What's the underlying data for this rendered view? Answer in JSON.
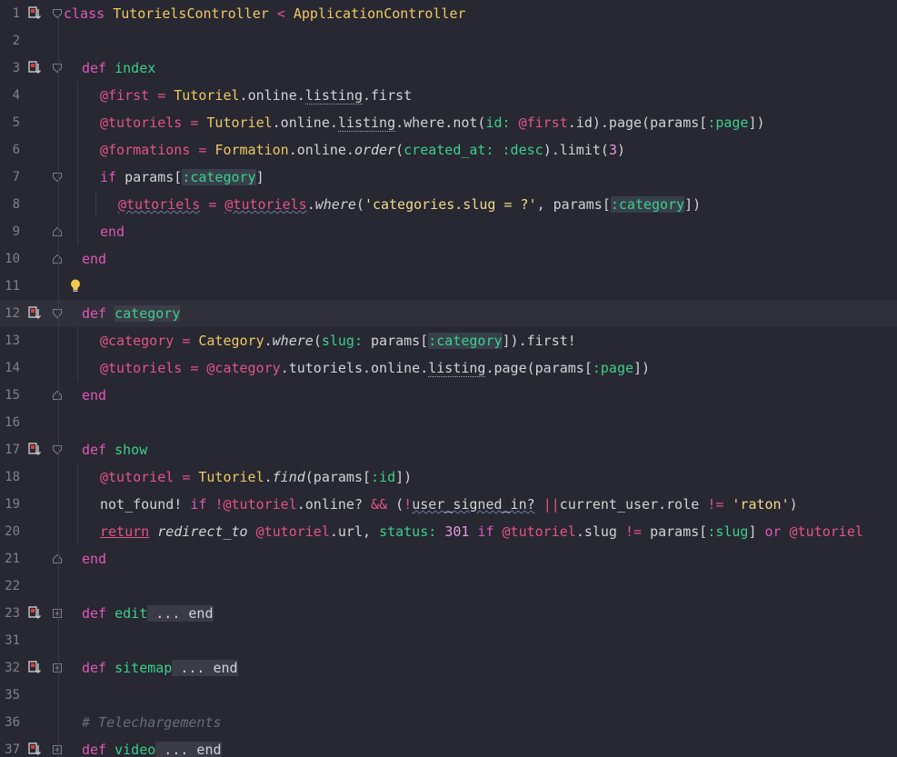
{
  "editor": {
    "lines": [
      {
        "n": "1",
        "tokens": [
          [
            "k",
            "class"
          ],
          [
            "",
            "&#32;"
          ],
          [
            "c",
            "TutorielsController"
          ],
          [
            "",
            "&#32;"
          ],
          [
            "i",
            "<"
          ],
          [
            "",
            "&#32;"
          ],
          [
            "c",
            "ApplicationController"
          ]
        ]
      }
    ]
  },
  "lines": [
    {
      "n": "1",
      "marker": true,
      "fold": "open",
      "indent": 0,
      "tokens": [
        [
          "k",
          "class"
        ],
        [
          "",
          " "
        ],
        [
          "c",
          "TutorielsController"
        ],
        [
          "",
          " "
        ],
        [
          "i",
          "<"
        ],
        [
          "",
          " "
        ],
        [
          "c",
          "ApplicationController"
        ]
      ]
    },
    {
      "n": "2",
      "tokens": []
    },
    {
      "n": "3",
      "marker": true,
      "fold": "open",
      "indent": 1,
      "tokens": [
        [
          "k",
          "def"
        ],
        [
          "",
          " "
        ],
        [
          "m",
          "index"
        ]
      ]
    },
    {
      "n": "4",
      "indent": 2,
      "tokens": [
        [
          "i",
          "@first"
        ],
        [
          "",
          " "
        ],
        [
          "i",
          "="
        ],
        [
          "",
          " "
        ],
        [
          "c",
          "Tutoriel"
        ],
        [
          "",
          "."
        ],
        [
          "",
          "online"
        ],
        [
          "",
          "."
        ],
        [
          "u",
          "listing"
        ],
        [
          "",
          "."
        ],
        [
          "",
          "first"
        ]
      ]
    },
    {
      "n": "5",
      "indent": 2,
      "tokens": [
        [
          "i",
          "@tutoriels"
        ],
        [
          "",
          " "
        ],
        [
          "i",
          "="
        ],
        [
          "",
          " "
        ],
        [
          "c",
          "Tutoriel"
        ],
        [
          "",
          ".online."
        ],
        [
          "u",
          "listing"
        ],
        [
          "",
          ".where.not("
        ],
        [
          "m",
          "id:"
        ],
        [
          "",
          " "
        ],
        [
          "i",
          "@first"
        ],
        [
          "",
          ".id).page(params["
        ],
        [
          "m",
          ":page"
        ],
        [
          "",
          "])"
        ]
      ]
    },
    {
      "n": "6",
      "indent": 2,
      "tokens": [
        [
          "i",
          "@formations"
        ],
        [
          "",
          " "
        ],
        [
          "i",
          "="
        ],
        [
          "",
          " "
        ],
        [
          "c",
          "Formation"
        ],
        [
          "",
          ".online."
        ],
        [
          "it",
          "order"
        ],
        [
          "",
          "("
        ],
        [
          "m",
          "created_at:"
        ],
        [
          "",
          " "
        ],
        [
          "m",
          ":desc"
        ],
        [
          "",
          ").limit("
        ],
        [
          "n",
          "3"
        ],
        [
          "",
          ")"
        ]
      ]
    },
    {
      "n": "7",
      "fold": "open",
      "indent": 2,
      "tokens": [
        [
          "k",
          "if"
        ],
        [
          "",
          " params["
        ],
        [
          "mhl",
          ":category"
        ],
        [
          "",
          "]"
        ]
      ]
    },
    {
      "n": "8",
      "indent": 3,
      "tokens": [
        [
          "iuw",
          "@tutoriels"
        ],
        [
          "",
          " "
        ],
        [
          "i",
          "="
        ],
        [
          "",
          " "
        ],
        [
          "iuw",
          "@tutoriels"
        ],
        [
          "",
          "."
        ],
        [
          "it",
          "where"
        ],
        [
          "",
          "("
        ],
        [
          "s",
          "'categories.slug = ?'"
        ],
        [
          "",
          ", params["
        ],
        [
          "mhl",
          ":category"
        ],
        [
          "",
          "])"
        ]
      ]
    },
    {
      "n": "9",
      "fold": "close",
      "indent": 2,
      "tokens": [
        [
          "k",
          "end"
        ]
      ]
    },
    {
      "n": "10",
      "fold": "close",
      "indent": 1,
      "tokens": [
        [
          "k",
          "end"
        ]
      ]
    },
    {
      "n": "11",
      "bulb": true,
      "tokens": []
    },
    {
      "n": "12",
      "marker": true,
      "fold": "open",
      "current": true,
      "indent": 1,
      "tokens": [
        [
          "k",
          "def"
        ],
        [
          "",
          " "
        ],
        [
          "msel",
          "category"
        ]
      ]
    },
    {
      "n": "13",
      "indent": 2,
      "tokens": [
        [
          "i",
          "@category"
        ],
        [
          "",
          " "
        ],
        [
          "i",
          "="
        ],
        [
          "",
          " "
        ],
        [
          "c",
          "Category"
        ],
        [
          "",
          "."
        ],
        [
          "it",
          "where"
        ],
        [
          "",
          "("
        ],
        [
          "m",
          "slug:"
        ],
        [
          "",
          " params["
        ],
        [
          "mhl",
          ":category"
        ],
        [
          "",
          "]).first!"
        ]
      ]
    },
    {
      "n": "14",
      "indent": 2,
      "tokens": [
        [
          "i",
          "@tutoriels"
        ],
        [
          "",
          " "
        ],
        [
          "i",
          "="
        ],
        [
          "",
          " "
        ],
        [
          "i",
          "@category"
        ],
        [
          "",
          ".tutoriels.online."
        ],
        [
          "u",
          "listing"
        ],
        [
          "",
          ".page(params["
        ],
        [
          "m",
          ":page"
        ],
        [
          "",
          "])"
        ]
      ]
    },
    {
      "n": "15",
      "fold": "close",
      "indent": 1,
      "tokens": [
        [
          "k",
          "end"
        ]
      ]
    },
    {
      "n": "16",
      "tokens": []
    },
    {
      "n": "17",
      "marker": true,
      "fold": "open",
      "indent": 1,
      "tokens": [
        [
          "k",
          "def"
        ],
        [
          "",
          " "
        ],
        [
          "m",
          "show"
        ]
      ]
    },
    {
      "n": "18",
      "indent": 2,
      "tokens": [
        [
          "i",
          "@tutoriel"
        ],
        [
          "",
          " "
        ],
        [
          "i",
          "="
        ],
        [
          "",
          " "
        ],
        [
          "c",
          "Tutoriel"
        ],
        [
          "",
          "."
        ],
        [
          "it",
          "find"
        ],
        [
          "",
          "(params["
        ],
        [
          "m",
          ":id"
        ],
        [
          "",
          "])"
        ]
      ]
    },
    {
      "n": "19",
      "indent": 2,
      "tokens": [
        [
          "",
          "not_found! "
        ],
        [
          "k",
          "if"
        ],
        [
          "",
          " "
        ],
        [
          "i",
          "!"
        ],
        [
          "i",
          "@tutoriel"
        ],
        [
          "",
          ".online? "
        ],
        [
          "i",
          "&&"
        ],
        [
          "",
          " ("
        ],
        [
          "i",
          "!"
        ],
        [
          "uw",
          "user_signed_in?"
        ],
        [
          "",
          " "
        ],
        [
          "i",
          "||"
        ],
        [
          "",
          "",
          " "
        ],
        [
          "",
          "current_user.role "
        ],
        [
          "i",
          "!="
        ],
        [
          "",
          " "
        ],
        [
          "s",
          "'raton'"
        ],
        [
          "",
          ")"
        ]
      ]
    },
    {
      "n": "20",
      "indent": 2,
      "tokens": [
        [
          "iur",
          "return"
        ],
        [
          "",
          " "
        ],
        [
          "it",
          "redirect_to"
        ],
        [
          "",
          " "
        ],
        [
          "i",
          "@tutoriel"
        ],
        [
          "",
          ".url, "
        ],
        [
          "m",
          "status:"
        ],
        [
          "",
          " "
        ],
        [
          "n",
          "301"
        ],
        [
          "",
          " "
        ],
        [
          "k",
          "if"
        ],
        [
          "",
          " "
        ],
        [
          "i",
          "@tutoriel"
        ],
        [
          "",
          ".slug "
        ],
        [
          "i",
          "!="
        ],
        [
          "",
          " params["
        ],
        [
          "m",
          ":slug"
        ],
        [
          "",
          "] "
        ],
        [
          "k",
          "or"
        ],
        [
          "",
          " "
        ],
        [
          "i",
          "@tutoriel"
        ]
      ]
    },
    {
      "n": "21",
      "fold": "close",
      "indent": 1,
      "tokens": [
        [
          "k",
          "end"
        ]
      ]
    },
    {
      "n": "22",
      "tokens": []
    },
    {
      "n": "23",
      "marker": true,
      "fold": "collapsed",
      "indent": 1,
      "tokens": [
        [
          "k",
          "def"
        ],
        [
          "",
          " "
        ],
        [
          "m",
          "edit"
        ],
        [
          "fb",
          " ... end"
        ]
      ]
    },
    {
      "n": "31",
      "tokens": []
    },
    {
      "n": "32",
      "marker": true,
      "fold": "collapsed",
      "indent": 1,
      "tokens": [
        [
          "k",
          "def"
        ],
        [
          "",
          " "
        ],
        [
          "m",
          "sitemap"
        ],
        [
          "fb",
          " ... end"
        ]
      ]
    },
    {
      "n": "35",
      "tokens": []
    },
    {
      "n": "36",
      "indent": 1,
      "tokens": [
        [
          "cm",
          "# Telechargements"
        ]
      ]
    },
    {
      "n": "37",
      "marker": true,
      "fold": "collapsed",
      "indent": 1,
      "tokens": [
        [
          "k",
          "def"
        ],
        [
          "",
          " "
        ],
        [
          "m",
          "video"
        ],
        [
          "fb",
          " ... end"
        ]
      ]
    }
  ]
}
